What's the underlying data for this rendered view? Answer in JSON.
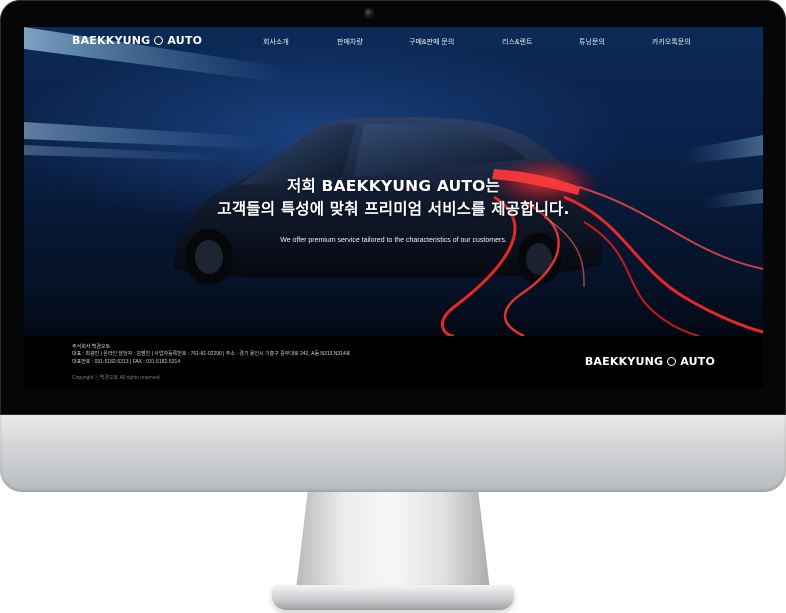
{
  "site": {
    "logo_left": "BAEKKYUNG",
    "logo_right": "AUTO"
  },
  "nav": {
    "items": [
      {
        "label": "회사소개"
      },
      {
        "label": "판매차량"
      },
      {
        "label": "구매&판매 문의"
      },
      {
        "label": "리스&렌트"
      },
      {
        "label": "튜닝문의"
      },
      {
        "label": "카카오톡문의"
      }
    ]
  },
  "hero": {
    "headline_line1": "저희 BAEKKYUNG AUTO는",
    "headline_line2": "고객들의 특성에 맞춰 프리미엄 서비스를 제공합니다.",
    "subline": "We offer premium service tailored to the characteristics of our customers."
  },
  "footer": {
    "company": "주식회사 백경오토",
    "info_line": "대표 : 최광민 | 온라인 담당자 : 김명진 | 사업자등록번호 : 761-81-02290 | 주소 : 경기 용인시 기흥구 중부대로 242, A동 N313,N314호",
    "contact_line": "대표번호 : 031-5182-5313 | FAX : 031-5182-5314",
    "copyright": "Copyright ⓒ백경오토 All rights reserved."
  },
  "colors": {
    "screen_bg": "#0a2148",
    "footer_bg": "#000000",
    "accent_red": "#ff2a2a",
    "text": "#ffffff"
  }
}
